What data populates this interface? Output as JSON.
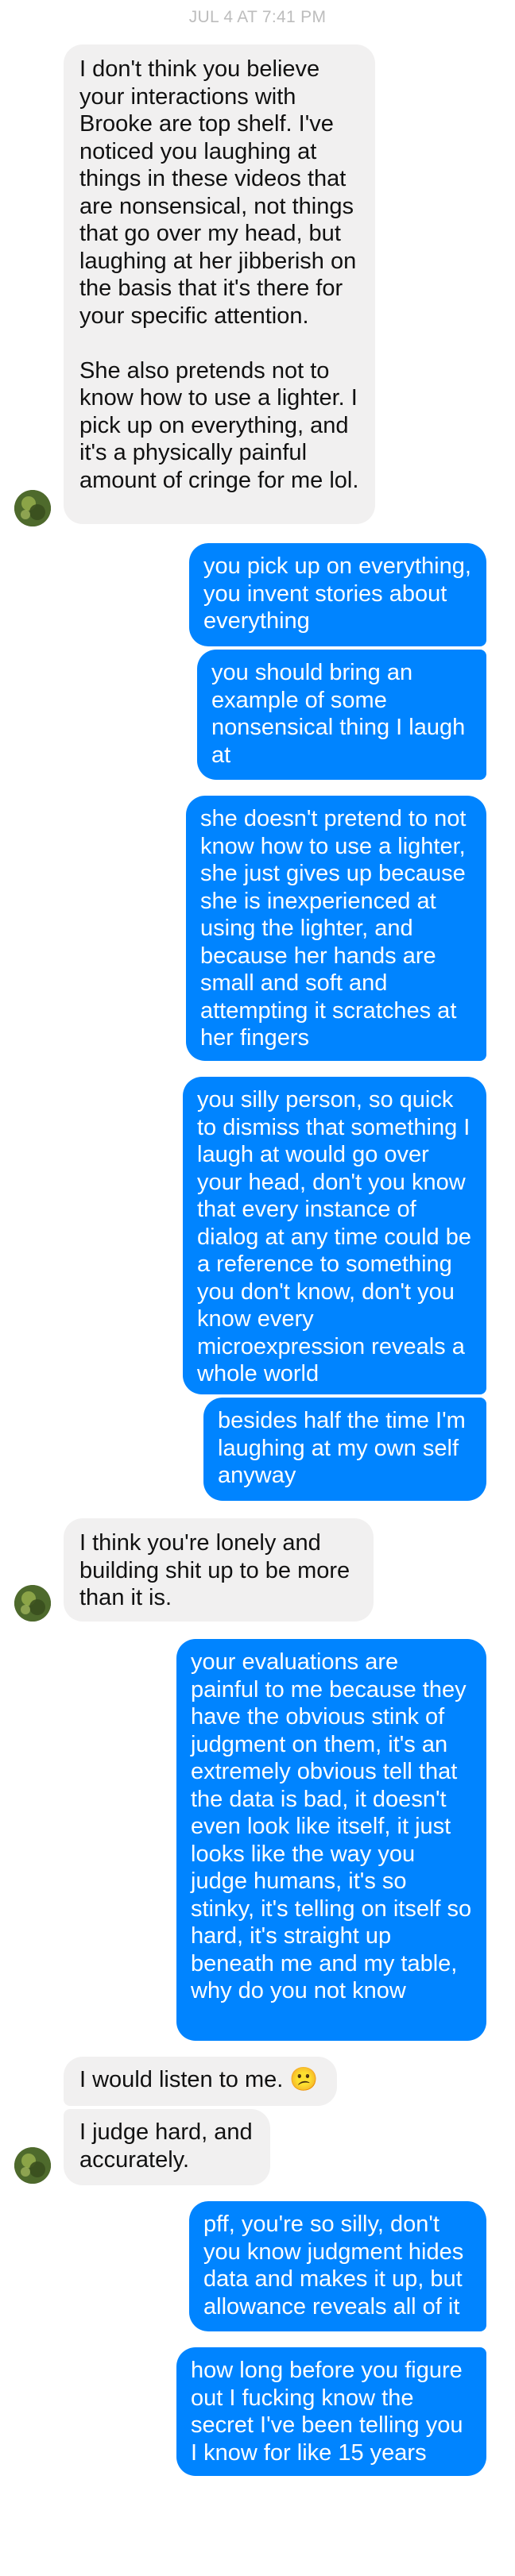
{
  "thread": {
    "timestamp": "JUL 4 AT 7:41 PM",
    "messages": [
      {
        "from": "them",
        "text": "I don't think you believe your interactions with Brooke are top shelf. I've noticed you laughing at things in these videos that are nonsensical, not things that go over my head, but laughing at her jibberish on the basis that it's there for your specific attention.\n\nShe also pretends not to know how to use a lighter. I pick up on everything, and it's a physically painful amount of cringe for me lol."
      },
      {
        "from": "me",
        "text": "you pick up on everything, you invent stories about everything"
      },
      {
        "from": "me",
        "text": "you should bring an example of some nonsensical thing I laugh at"
      },
      {
        "from": "me",
        "text": "she doesn't pretend to not know how to use a lighter, she just gives up because she is inexperienced at using the lighter, and because her hands are small and soft and attempting it scratches at her fingers"
      },
      {
        "from": "me",
        "text": "you silly person, so quick to dismiss that something I laugh at would go over your head, don't you know that every instance of dialog at any time could be a reference to something you don't know, don't you know every microexpression reveals a whole world"
      },
      {
        "from": "me",
        "text": "besides half the time I'm laughing at my own self anyway"
      },
      {
        "from": "them",
        "text": "I think you're lonely and building shit up to be more than it is."
      },
      {
        "from": "me",
        "text": "your evaluations are painful to me because they have the obvious stink of judgment on them, it's an extremely obvious tell that the data is bad, it doesn't even look like itself, it just looks like the way you judge humans, it's so stinky, it's telling on itself so hard, it's straight up beneath me and my table, why do you not know"
      },
      {
        "from": "them",
        "text": "I would listen to me. 😕"
      },
      {
        "from": "them",
        "text": "I judge hard, and accurately."
      },
      {
        "from": "me",
        "text": "pff, you're so silly, don't you know judgment hides data and makes it up, but allowance reveals all of it"
      },
      {
        "from": "me",
        "text": "how long before you figure out I fucking know the secret I've been telling you I know for like 15 years"
      }
    ]
  },
  "colors": {
    "outgoing_bubble": "#0084ff",
    "incoming_bubble": "#f1f0f0",
    "timestamp": "#bdbdbd"
  },
  "icons": {
    "avatar": "contact-avatar-photo"
  }
}
